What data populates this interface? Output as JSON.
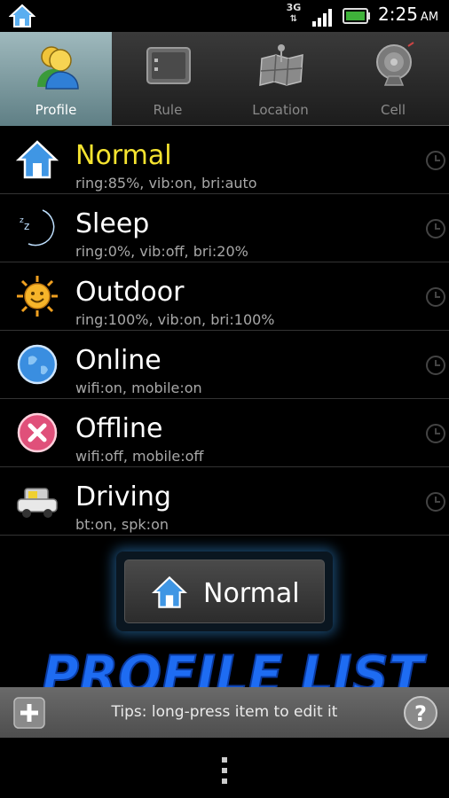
{
  "status_bar": {
    "network": "3G",
    "time": "2:25",
    "ampm": "AM",
    "icons": [
      "home-icon",
      "3g-icon",
      "signal-icon",
      "battery-icon"
    ],
    "battery_color": "#3fb23a"
  },
  "tabs": [
    {
      "label": "Profile",
      "icon": "profile-people-icon",
      "active": true
    },
    {
      "label": "Rule",
      "icon": "rule-panel-icon",
      "active": false
    },
    {
      "label": "Location",
      "icon": "location-map-icon",
      "active": false
    },
    {
      "label": "Cell",
      "icon": "cell-tower-icon",
      "active": false
    }
  ],
  "profiles": [
    {
      "name": "Normal",
      "detail": "ring:85%, vib:on, bri:auto",
      "icon": "home-icon",
      "selected": true
    },
    {
      "name": "Sleep",
      "detail": "ring:0%, vib:off, bri:20%",
      "icon": "moon-icon",
      "selected": false
    },
    {
      "name": "Outdoor",
      "detail": "ring:100%, vib:on, bri:100%",
      "icon": "sun-icon",
      "selected": false
    },
    {
      "name": "Online",
      "detail": "wifi:on, mobile:on",
      "icon": "globe-icon",
      "selected": false
    },
    {
      "name": "Offline",
      "detail": "wifi:off, mobile:off",
      "icon": "cross-circle-icon",
      "selected": false
    },
    {
      "name": "Driving",
      "detail": "bt:on, spk:on",
      "icon": "car-icon",
      "selected": false
    }
  ],
  "current_profile": {
    "label": "Normal",
    "icon": "home-icon"
  },
  "caption": "PROFILE LIST",
  "tips": {
    "text": "Tips: long-press item to edit it"
  },
  "colors": {
    "selected_title": "#f5e330",
    "active_tab": "#8fabaf",
    "caption": "#1e6cf2"
  }
}
